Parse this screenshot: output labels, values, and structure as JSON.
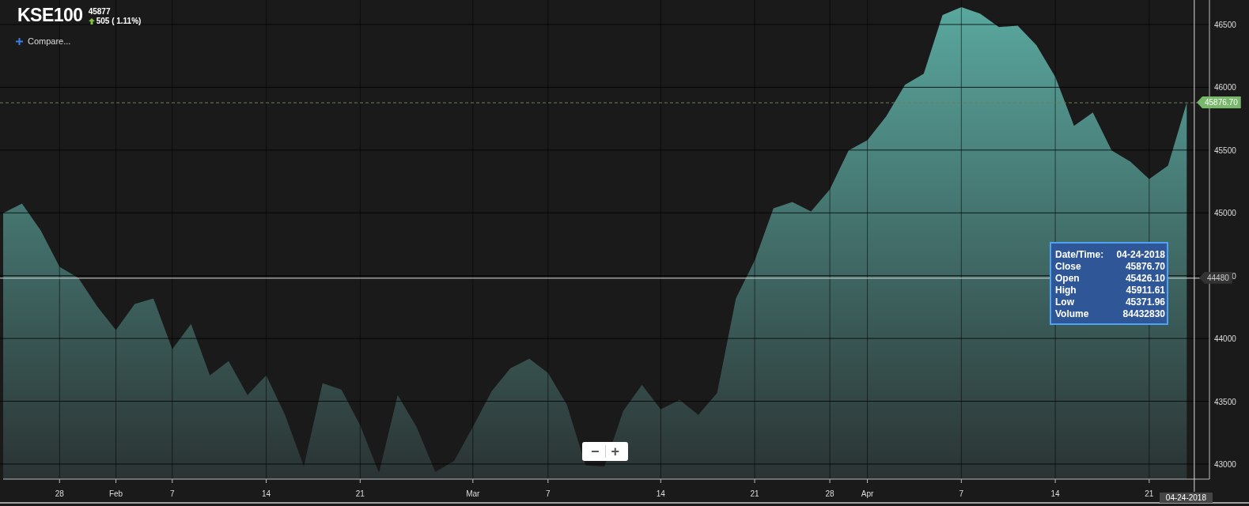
{
  "header": {
    "symbol": "KSE100",
    "last": "45877",
    "change": "505 ( 1.11%)",
    "rising": true
  },
  "compare": {
    "label": "Compare..."
  },
  "chart": {
    "chart_data": {
      "type": "area",
      "categories": [
        null,
        null,
        null,
        "28",
        null,
        null,
        "Feb",
        null,
        null,
        "7",
        null,
        null,
        null,
        null,
        "14",
        null,
        null,
        null,
        null,
        "21",
        null,
        null,
        null,
        null,
        null,
        "Mar",
        null,
        null,
        null,
        "7",
        null,
        null,
        null,
        null,
        null,
        "14",
        null,
        null,
        null,
        null,
        "21",
        null,
        null,
        null,
        "28",
        null,
        "Apr",
        null,
        null,
        null,
        null,
        "7",
        null,
        null,
        null,
        null,
        "14",
        null,
        null,
        null,
        null,
        "21",
        null,
        null
      ],
      "series": [
        {
          "color": "#5aa9a0",
          "values": [
            44999,
            45074,
            44860,
            44570,
            44482,
            44255,
            44066,
            44274,
            44318,
            43914,
            44116,
            43706,
            43820,
            43549,
            43706,
            43391,
            42981,
            43643,
            43593,
            43309,
            42931,
            43549,
            43296,
            42937,
            43025,
            43296,
            43580,
            43763,
            43839,
            43725,
            43473,
            42990,
            42981,
            43422,
            43631,
            43435,
            43511,
            43391,
            43567,
            44318,
            44620,
            45037,
            45087,
            45011,
            45188,
            45497,
            45579,
            45768,
            46020,
            46108,
            46575,
            46638,
            46587,
            46480,
            46490,
            46335,
            46083,
            45692,
            45800,
            45497,
            45408,
            45270,
            45377,
            45877
          ]
        }
      ],
      "ylim": [
        42880,
        46695
      ],
      "yticks": [
        43000,
        43500,
        44000,
        44500,
        45000,
        45500,
        46000,
        46500
      ],
      "grid": true,
      "ref_lines": [
        {
          "axis": "y",
          "value": 45876.7,
          "label": "45876.70"
        },
        {
          "axis": "y",
          "value": 44480,
          "label": "44480"
        }
      ]
    },
    "crosshair": {
      "date": "04-24-2018"
    },
    "tooltip": {
      "rows": [
        {
          "label": "Date/Time:",
          "value": "04-24-2018"
        },
        {
          "label": "Close",
          "value": "45876.70"
        },
        {
          "label": "Open",
          "value": "45426.10"
        },
        {
          "label": "High",
          "value": "45911.61"
        },
        {
          "label": "Low",
          "value": "45371.96"
        },
        {
          "label": "Volume",
          "value": "84432830"
        }
      ]
    }
  },
  "zoom": {
    "out": "−",
    "in": "+"
  }
}
